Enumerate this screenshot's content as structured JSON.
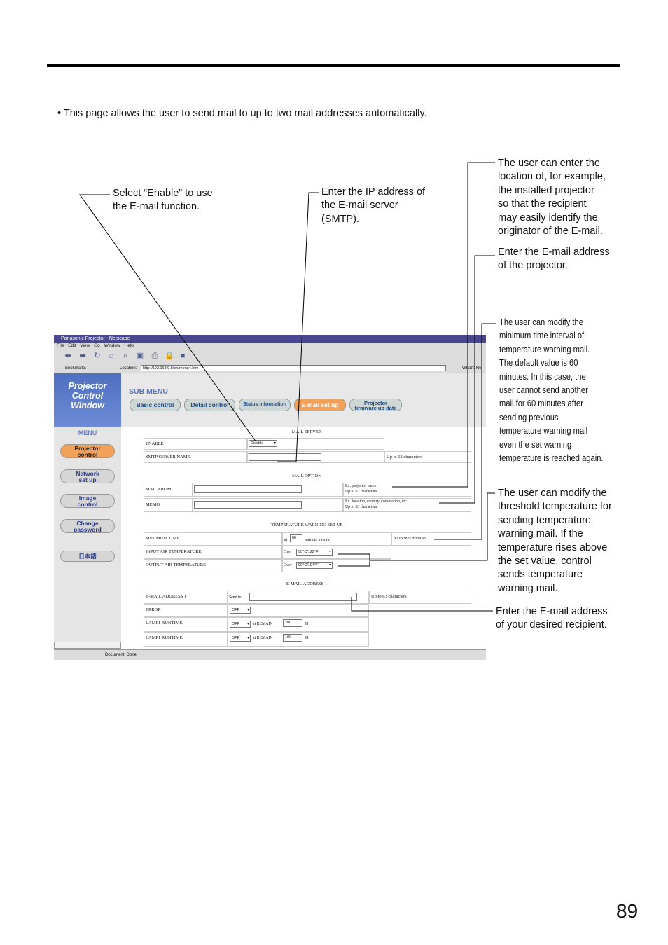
{
  "intro": "• This page allows the user to send mail to up to two mail addresses automatically.",
  "page_number": "89",
  "callouts": {
    "enable": "Select “Enable” to use\nthe E-mail function.",
    "smtp": "Enter the IP address of\nthe E-mail server\n(SMTP).",
    "location": "The user can enter the\nlocation of, for example,\nthe installed projector\nso that the recipient\nmay easily identify the\noriginator of the E-mail.",
    "projector_address": "Enter the E-mail address\nof the projector.",
    "min_time": "The user can modify the\nminimum time interval of\ntemperature warning mail.\nThe default value is 60\nminutes.  In this case, the\nuser cannot send another\nmail for 60 minutes after\nsending previous\ntemperature warning mail\neven the set warning\ntemperature is reached again.",
    "threshold": "The user can modify the\nthreshold temperature for\nsending temperature\nwarning mail. If the\ntemperature rises above\nthe set value, control\nsends temperature\nwarning mail.",
    "recipient": "Enter the E-mail address\nof your desired recipient."
  },
  "browser": {
    "title": "Panasonic Projector - Netscape",
    "menus": [
      "File",
      "Edit",
      "View",
      "Go",
      "Window",
      "Help"
    ],
    "bookmarks": "Bookmarks",
    "location_label": "Location:",
    "url": "http://192.168.0.8/en/menu4.htm",
    "whats_related": "What's Rel",
    "status": "Document: Done"
  },
  "app": {
    "brand": "Projector\nControl\nWindow",
    "menu_label": "MENU",
    "sidebar": [
      "Projector\ncontrol",
      "Network\nset up",
      "Image\ncontrol",
      "Change\npassword",
      "日本語"
    ],
    "submenu_label": "SUB MENU",
    "tabs": [
      "Basic control",
      "Detail control",
      "Status information",
      "E-mail set up",
      "Projector\nfirmware up date"
    ],
    "sections": {
      "mail_server": "MAIL SERVER",
      "mail_option": "MAIL OPTION",
      "temp_warning": "TEMPERATURE WARNING SET UP",
      "email_address": "E-MAIL ADDRESS 1"
    },
    "fields": {
      "enable_label": "ENABLE",
      "enable_value": "Disable",
      "smtp_label": "SMTP SERVER NAME",
      "smtp_hint": "Up to 63 characters",
      "mail_from_label": "MAIL FROM",
      "mail_from_hint1": "Ex. projector name",
      "mail_from_hint2": "Up to 63 characters",
      "memo_label": "MEMO",
      "memo_hint1": "Ex. location, country, corporation, etc...",
      "memo_hint2": "Up to 63 characters",
      "min_time_label": "MINIMUM TIME",
      "min_time_at": "at",
      "min_time_value": "60",
      "min_time_unit": "-minute interval",
      "min_time_hint": "30 to 999 minutes",
      "input_air_label": "INPUT AIR TEMPERATURE",
      "input_air_over": "Over",
      "input_air_value": "50°C/122°F",
      "output_air_label": "OUTPUT AIR TEMPERATURE",
      "output_air_over": "Over",
      "output_air_value": "90°C/194°F",
      "email1_label": "E-MAIL ADDRESS 1",
      "send_to": "Send to",
      "email1_hint": "Up to 63 characters",
      "error_label": "ERROR",
      "error_value": "OFF",
      "lamp1_label": "LAMP1 RUNTIME",
      "lamp1_value": "OFF",
      "lamp1_remain": "at REMAIN",
      "lamp1_hours": "200",
      "lamp1_unit": "H",
      "lamp2_label": "LAMP1 RUNTIME",
      "lamp2_value": "OFF",
      "lamp2_remain": "at REMAIN",
      "lamp2_hours": "100",
      "lamp2_unit": "H"
    }
  }
}
